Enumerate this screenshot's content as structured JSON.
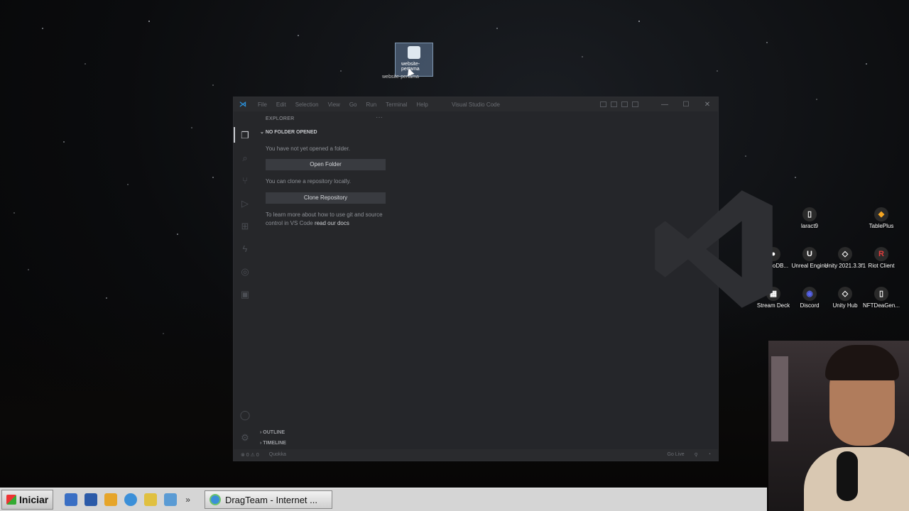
{
  "desktop": {
    "dragged_icon_label": "website-pertama",
    "icons": [
      {
        "label": "laract9",
        "glyph": "▯",
        "color": "#f2f2f2"
      },
      {
        "label": "TablePlus",
        "glyph": "◆",
        "color": "#f5a623"
      },
      {
        "label": "MongoDB...",
        "glyph": "●",
        "color": "#ffffff"
      },
      {
        "label": "Unreal Engine",
        "glyph": "U",
        "color": "#ffffff"
      },
      {
        "label": "Unity 2021.3.3f1",
        "glyph": "◇",
        "color": "#ffffff"
      },
      {
        "label": "Riot Client",
        "glyph": "R",
        "color": "#e23d3d"
      },
      {
        "label": "Stream Deck",
        "glyph": "▦",
        "color": "#ffffff"
      },
      {
        "label": "Discord",
        "glyph": "◉",
        "color": "#5865f2"
      },
      {
        "label": "Unity Hub",
        "glyph": "◇",
        "color": "#ffffff"
      },
      {
        "label": "NFTDeaGen...",
        "glyph": "▯",
        "color": "#f2f2f2"
      }
    ]
  },
  "vscode": {
    "window_title": "Visual Studio Code",
    "menu": [
      "File",
      "Edit",
      "Selection",
      "View",
      "Go",
      "Run",
      "Terminal",
      "Help"
    ],
    "sidebar": {
      "header": "EXPLORER",
      "section": "NO FOLDER OPENED",
      "text_not_opened": "You have not yet opened a folder.",
      "open_folder": "Open Folder",
      "text_clone": "You can clone a repository locally.",
      "clone_repository": "Clone Repository",
      "text_learn": "To learn more about how to use git and source control in VS Code",
      "read_docs": "read our docs",
      "outline": "OUTLINE",
      "timeline": "TIMELINE"
    },
    "status": {
      "problems": "⊗ 0 ⚠ 0",
      "quokka": "Quokka",
      "go_live": "Go Live"
    },
    "accent": "#2b8fd6"
  },
  "taskbar": {
    "start_label": "Iniciar",
    "task_label": "DragTeam - Internet ..."
  }
}
